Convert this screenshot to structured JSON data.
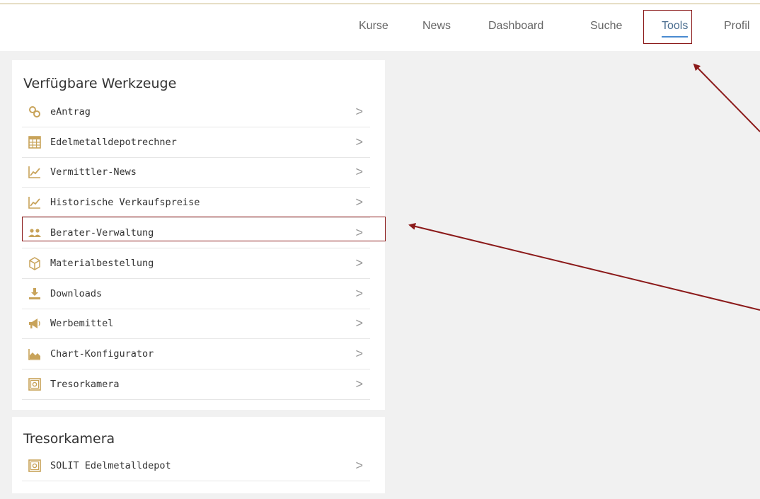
{
  "nav": {
    "items": [
      {
        "label": "Kurse",
        "active": false
      },
      {
        "label": "News",
        "active": false
      },
      {
        "label": "Dashboard",
        "active": false
      },
      {
        "label": "Suche",
        "active": false
      },
      {
        "label": "Tools",
        "active": true
      },
      {
        "label": "Profil",
        "active": false
      }
    ]
  },
  "tools_card": {
    "title": "Verfügbare Werkzeuge",
    "items": [
      {
        "label": "eAntrag",
        "icon": "link-icon"
      },
      {
        "label": "Edelmetalldepotrechner",
        "icon": "calculator-icon"
      },
      {
        "label": "Vermittler-News",
        "icon": "line-chart-icon"
      },
      {
        "label": "Historische Verkaufspreise",
        "icon": "line-chart-icon"
      },
      {
        "label": "Berater-Verwaltung",
        "icon": "users-icon"
      },
      {
        "label": "Materialbestellung",
        "icon": "box-icon"
      },
      {
        "label": "Downloads",
        "icon": "download-icon"
      },
      {
        "label": "Werbemittel",
        "icon": "megaphone-icon"
      },
      {
        "label": "Chart-Konfigurator",
        "icon": "area-chart-icon"
      },
      {
        "label": "Tresorkamera",
        "icon": "safe-icon"
      }
    ]
  },
  "vault_card": {
    "title": "Tresorkamera",
    "items": [
      {
        "label": "SOLIT Edelmetalldepot",
        "icon": "safe-icon"
      }
    ]
  },
  "colors": {
    "accent_gold": "#c8a35a",
    "highlight_red": "#8b1a1a",
    "active_underline": "#4a8bd0"
  },
  "chevron": ">"
}
